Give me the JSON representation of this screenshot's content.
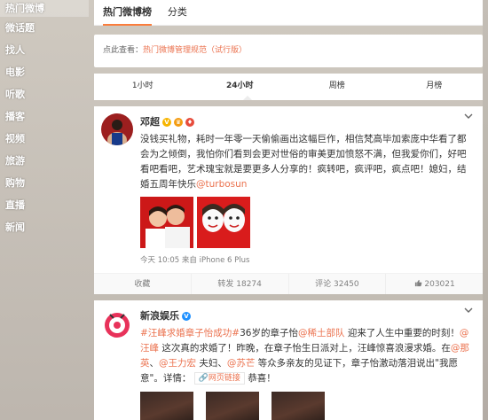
{
  "sidebar": {
    "items": [
      {
        "label": "热门微博",
        "active": true
      },
      {
        "label": "微话题"
      },
      {
        "label": "找人"
      },
      {
        "label": "电影"
      },
      {
        "label": "听歌"
      },
      {
        "label": "播客"
      },
      {
        "label": "视频"
      },
      {
        "label": "旅游"
      },
      {
        "label": "购物"
      },
      {
        "label": "直播"
      },
      {
        "label": "新闻"
      }
    ]
  },
  "header": {
    "tabs": [
      {
        "label": "热门微博榜",
        "active": true
      },
      {
        "label": "分类"
      }
    ]
  },
  "notice": {
    "prefix": "点此查看：",
    "link": "热门微博管理规范（试行版）"
  },
  "time_tabs": [
    {
      "label": "1小时"
    },
    {
      "label": "24小时",
      "active": true
    },
    {
      "label": "周榜"
    },
    {
      "label": "月榜"
    }
  ],
  "posts": [
    {
      "author": "邓超",
      "text_a": "没钱买礼物，耗时一年零一天偷偷画出这幅巨作，相信梵高毕加索庞中华看了都会为之倾倒，我怕你们看到会更对世俗的审美更加愤怒不满，但我爱你们，好吧看吧看吧，艺术瑰宝就是要更多人分享的！疯转吧，疯评吧，疯点吧！媳妇，结婚五周年快乐",
      "mention": "@turbosun",
      "meta_time": "今天 10:05",
      "meta_from": "来自",
      "meta_source": "iPhone 6 Plus",
      "actions": {
        "collect": "收藏",
        "repost": "转发 18274",
        "comment": "评论 32450",
        "like": "203021"
      }
    },
    {
      "author": "新浪娱乐",
      "topic": "#汪峰求婚章子怡成功#",
      "text_a": "36岁的章子怡",
      "mention1": "@稀土部队",
      "text_b": " 迎来了人生中重要的时刻！",
      "mention2": "@汪峰",
      "text_c": " 这次真的求婚了！昨晚，在章子怡生日派对上，汪峰惊喜浪漫求婚。在",
      "mention3": "@那英",
      "text_d": "、",
      "mention4": "@王力宏",
      "text_e": " 夫妇、",
      "mention5": "@苏芒",
      "text_f": " 等众多亲友的见证下，章子怡激动落泪说出\"我愿意\"。详情：",
      "weblink": "网页链接",
      "text_g": " 恭喜！"
    }
  ],
  "colors": {
    "accent": "#eb7350",
    "tab_underline": "#fa7d3c",
    "vip_badge": "#f7b500"
  }
}
